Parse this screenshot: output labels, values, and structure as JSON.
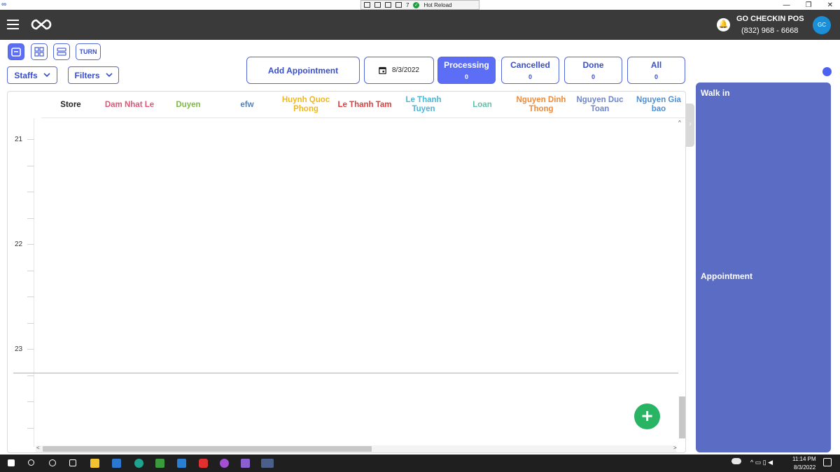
{
  "window": {
    "app_icon": "infinity-icon",
    "debug_toolbar": {
      "badge": "7",
      "hot_reload_label": "Hot Reload"
    },
    "controls": {
      "minimize": "—",
      "restore": "❐",
      "close": "✕"
    }
  },
  "header": {
    "store_name": "GO CHECKIN POS",
    "phone": "(832) 968 - 6668",
    "avatar_initials": "GC"
  },
  "toolbar": {
    "turn_label": "TURN",
    "staffs_label": "Staffs",
    "filters_label": "Filters",
    "add_appointment_label": "Add Appointment",
    "date": "8/3/2022",
    "statuses": [
      {
        "label": "Processing",
        "count": "0",
        "active": true
      },
      {
        "label": "Cancelled",
        "count": "0",
        "active": false
      },
      {
        "label": "Done",
        "count": "0",
        "active": false
      },
      {
        "label": "All",
        "count": "0",
        "active": false
      }
    ]
  },
  "calendar": {
    "columns": [
      {
        "label": "Store",
        "color": "#222222"
      },
      {
        "label": "Dam Nhat Le",
        "color": "#e05577"
      },
      {
        "label": "Duyen",
        "color": "#7dbb3e"
      },
      {
        "label": "efw",
        "color": "#4f7fc0"
      },
      {
        "label": "Huynh Quoc Phong",
        "color": "#f0b820"
      },
      {
        "label": "Le Thanh Tam",
        "color": "#d94040"
      },
      {
        "label": "Le Thanh Tuyen",
        "color": "#4bb6d8"
      },
      {
        "label": "Loan",
        "color": "#5ec0a8"
      },
      {
        "label": "Nguyen Dinh Thong",
        "color": "#ee8a3a"
      },
      {
        "label": "Nguyen Duc Toan",
        "color": "#6f86c9"
      },
      {
        "label": "Nguyen Gia bao",
        "color": "#4d90d6"
      }
    ],
    "hours": [
      "21",
      "22",
      "23"
    ]
  },
  "right_panel": {
    "walk_in_title": "Walk in",
    "appointment_title": "Appointment"
  },
  "taskbar": {
    "time": "11:14 PM",
    "date": "8/3/2022"
  },
  "colors": {
    "header_bg": "#3a3a3a",
    "accent": "#5b6ef5",
    "panel": "#5a6cc4",
    "fab": "#28b463"
  }
}
